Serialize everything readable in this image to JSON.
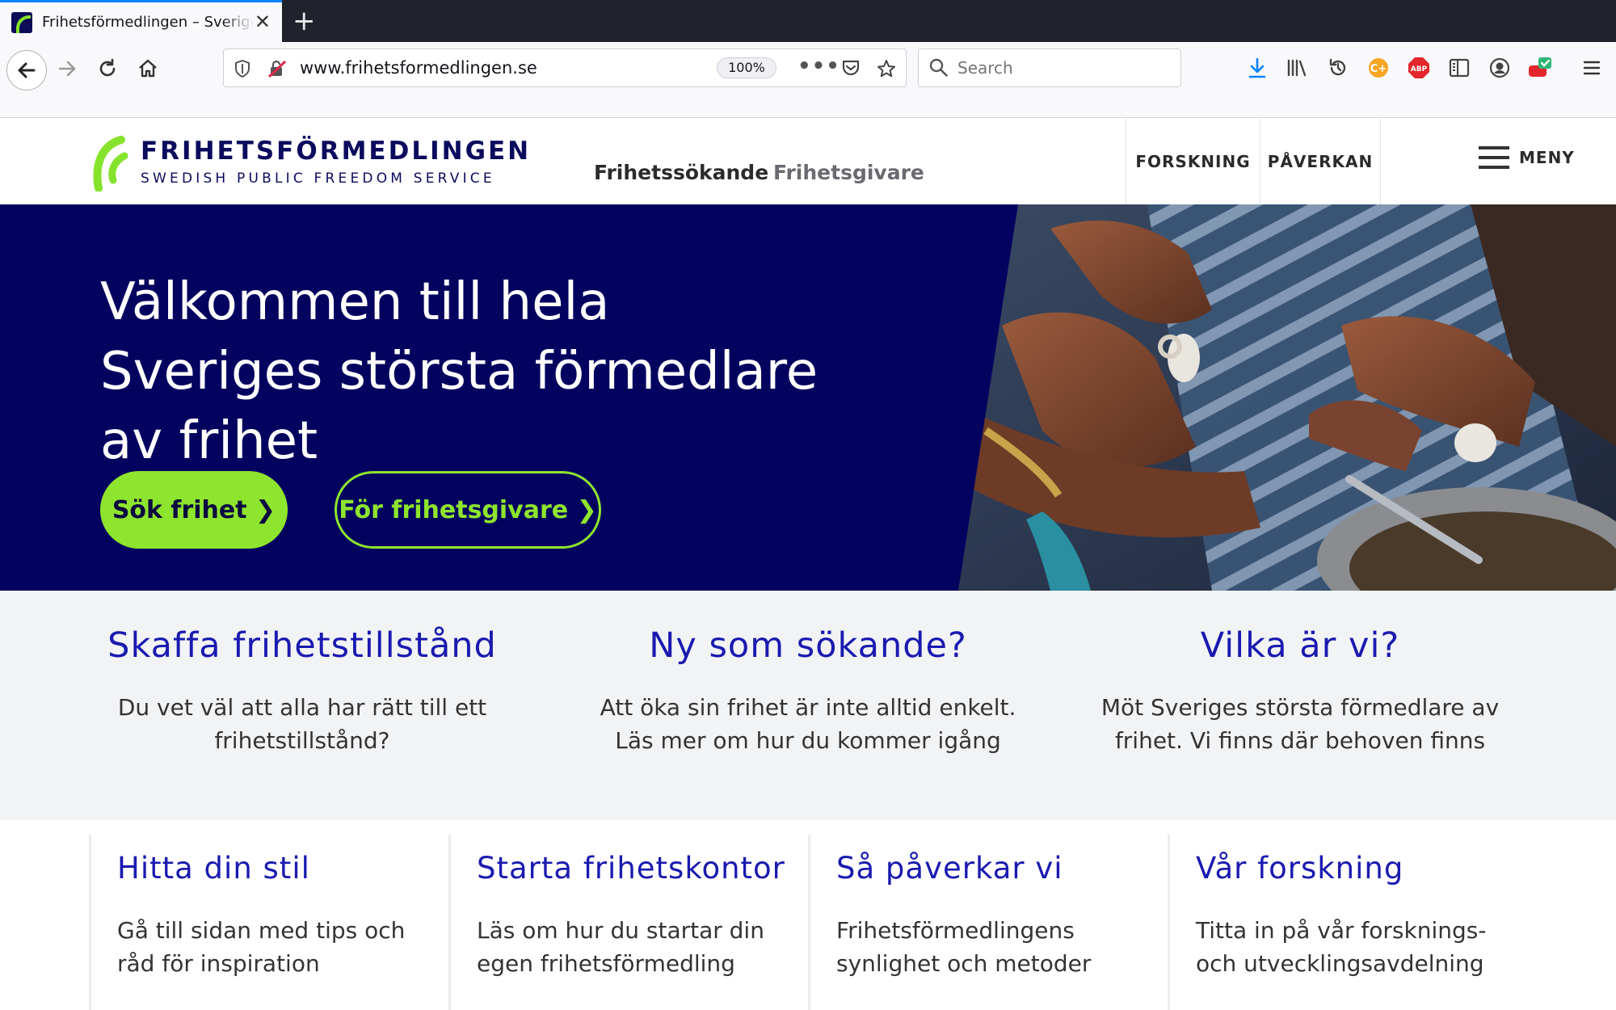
{
  "browser": {
    "tab_title": "Frihetsförmedlingen – Sveriges",
    "url": "www.frihetsformedlingen.se",
    "zoom": "100%",
    "search_placeholder": "Search",
    "overflow_label": "•••"
  },
  "site": {
    "logo_name": "FRIHETSFÖRMEDLINGEN",
    "logo_tagline": "SWEDISH PUBLIC FREEDOM SERVICE",
    "nav_primary": "Frihetssökande",
    "nav_secondary": "Frihetsgivare",
    "link_research": "FORSKNING",
    "link_influence": "PÅVERKAN",
    "menu_label": "MENY",
    "brand_colors": {
      "navy": "#03035f",
      "green": "#8ee52d",
      "link_blue": "#1a1ab0"
    }
  },
  "hero": {
    "title": "Välkommen till hela Sveriges största förmedlare av frihet",
    "primary_button": "Sök frihet ❯",
    "secondary_button": "För frihetsgivare ❯"
  },
  "info": [
    {
      "title": "Skaffa frihetstillstånd",
      "text": "Du vet väl att alla har rätt till ett frihetstillstånd?"
    },
    {
      "title": "Ny som sökande?",
      "text": "Att öka sin frihet är inte alltid enkelt. Läs mer om hur du kommer igång"
    },
    {
      "title": "Vilka är vi?",
      "text": "Möt Sveriges största förmedlare av frihet. Vi finns där behoven finns"
    }
  ],
  "cards": [
    {
      "title": "Hitta din stil",
      "text": "Gå till sidan med tips och råd för inspiration"
    },
    {
      "title": "Starta frihetskontor",
      "text": "Läs om hur du startar din egen frihetsförmedling"
    },
    {
      "title": "Så påverkar vi",
      "text": "Frihetsförmedlingens synlighet och metoder"
    },
    {
      "title": "Vår forskning",
      "text": "Titta in på vår forsknings- och utvecklingsavdelning"
    }
  ]
}
